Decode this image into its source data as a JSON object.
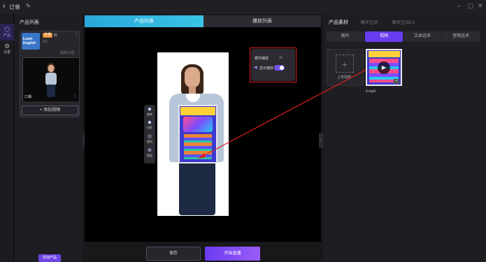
{
  "titlebar": {
    "back": "‹",
    "title": "订单",
    "edit": "✎",
    "minimize": "–",
    "maximize": "▢",
    "close": "✕"
  },
  "nav": [
    {
      "label": "产品",
      "icon": "⬡"
    },
    {
      "label": "设置",
      "icon": "⚙"
    }
  ],
  "left_panel": {
    "title": "产品列表",
    "product": {
      "thumb_text": "Learn English",
      "badge": "直播",
      "name": "的",
      "menu": "⋮",
      "sub": "1/1",
      "link": "视频分组"
    },
    "video_name": "口播",
    "video_menu": "⋮",
    "add_video": "+ 添加视频",
    "add_product": "添加产品"
  },
  "tabs": [
    {
      "label": "产品列表"
    },
    {
      "label": "播放列表"
    }
  ],
  "float_toolbar": [
    {
      "label": "旋转",
      "icon": "◆"
    },
    {
      "label": "拉框",
      "icon": "◆"
    },
    {
      "label": "遮挡",
      "icon": "◎"
    },
    {
      "label": "图层",
      "icon": "⊕"
    }
  ],
  "popup": {
    "title": "循环播放",
    "value": "3s",
    "toggle_label": "显示播放",
    "toggle_on": true
  },
  "bottom": {
    "save": "保存",
    "start_live": "开始直播"
  },
  "right_panel": {
    "tabs": [
      "产品素材",
      "聊天互动",
      "聊天互动2.0"
    ],
    "sub_tabs": [
      "图片",
      "视频",
      "文本话术",
      "音频话术"
    ],
    "active_sub_tab": 1,
    "upload_label": "上传视频",
    "media_name": "4.mp4",
    "media_delete": "🗑"
  },
  "colors": {
    "accent": "#6a3cf0",
    "tab_active": "#2aa8d9",
    "annotation": "#e02020"
  }
}
